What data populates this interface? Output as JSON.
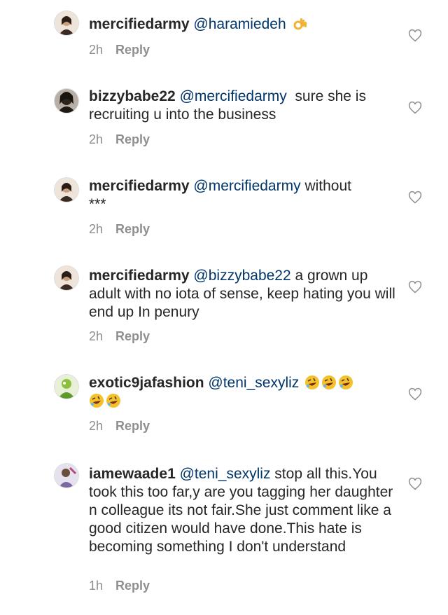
{
  "comments": [
    {
      "username": "mercifiedarmy",
      "mention": "@haramiedeh",
      "text": "",
      "emoji": [
        "ok-hand-emoji"
      ],
      "emoji_line2": [],
      "time": "2h",
      "reply": "Reply",
      "avatar_color": "#c9a07a"
    },
    {
      "username": "bizzybabe22",
      "mention": "@mercifiedarmy",
      "text": "  sure she is recruiting u into the business",
      "emoji": [],
      "emoji_line2": [],
      "time": "2h",
      "reply": "Reply",
      "avatar_color": "#3a3026"
    },
    {
      "username": "mercifiedarmy",
      "mention": "@mercifiedarmy",
      "text": " without\n***",
      "emoji": [],
      "emoji_line2": [],
      "time": "2h",
      "reply": "Reply",
      "avatar_color": "#c9a07a"
    },
    {
      "username": "mercifiedarmy",
      "mention": "@bizzybabe22",
      "text": " a grown up adult with no iota of sense, keep hating you will end up In penury",
      "emoji": [],
      "emoji_line2": [],
      "time": "2h",
      "reply": "Reply",
      "avatar_color": "#c9a07a"
    },
    {
      "username": "exotic9jafashion",
      "mention": "@teni_sexyliz",
      "text": "",
      "emoji": [
        "rofl-emoji",
        "rofl-emoji",
        "rofl-emoji"
      ],
      "emoji_line2": [
        "rofl-emoji",
        "rofl-emoji"
      ],
      "time": "2h",
      "reply": "Reply",
      "avatar_color": "#7fbf3a"
    },
    {
      "username": "iamewaade1",
      "mention": "@teni_sexyliz",
      "text": " stop all this.You took this too far,y are you tagging her daughter n colleague its not fair.She just comment like a good citizen would have done.This hate is becoming something I don't understand",
      "emoji": [],
      "emoji_line2": [],
      "time": "1h",
      "reply": "Reply",
      "avatar_color": "#8a7ea8"
    }
  ],
  "colors": {
    "text": "#262626",
    "mention": "#003569",
    "meta": "#8e8e8e",
    "heart": "#8e8e8e"
  }
}
